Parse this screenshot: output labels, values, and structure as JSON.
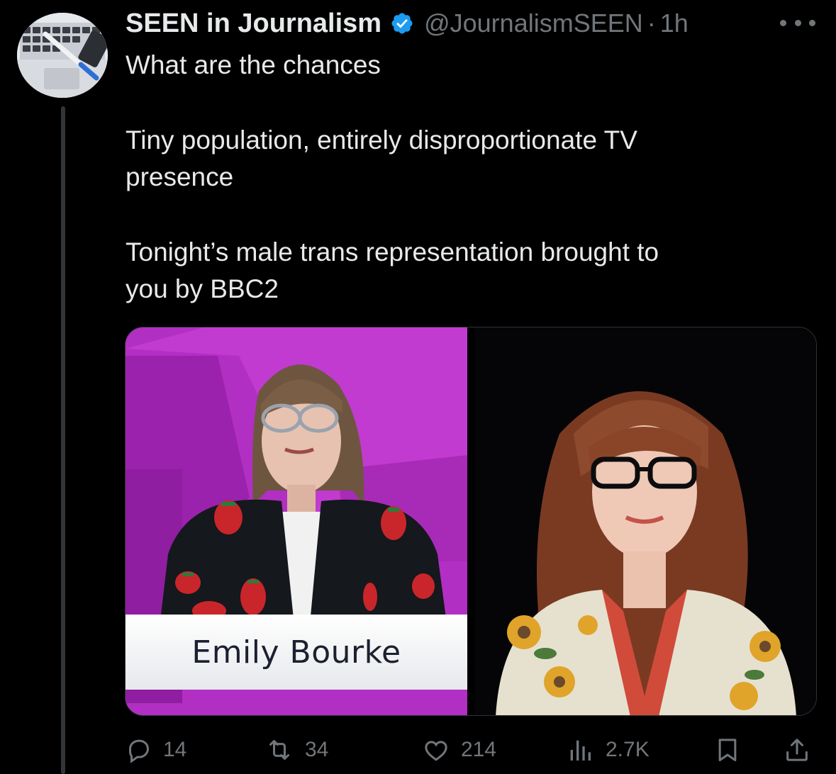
{
  "tweet": {
    "author": {
      "display_name": "SEEN in Journalism",
      "handle": "@JournalismSEEN",
      "verified": true,
      "avatar_icon": "laptop-keyboard-pen-avatar"
    },
    "separator": "·",
    "time": "1h",
    "text_lines": [
      "What are the chances",
      "Tiny population, entirely disproportionate TV",
      "presence",
      "Tonight’s male trans representation brought to",
      "you by BBC2"
    ],
    "media": {
      "left_caption": "Emily Bourke"
    },
    "actions": {
      "replies": "14",
      "reposts": "34",
      "likes": "214",
      "views": "2.7K"
    }
  },
  "colors": {
    "background": "#000000",
    "text": "#e7e9ea",
    "muted": "#71767b",
    "verified": "#1d9bf0",
    "studio_magenta": "#b02fc0"
  },
  "icons": {
    "verified": "verified-badge-icon",
    "more": "more-dots-icon",
    "reply": "reply-bubble-icon",
    "repost": "repost-arrows-icon",
    "like": "heart-icon",
    "views": "views-bar-chart-icon",
    "bookmark": "bookmark-icon",
    "share": "share-upload-icon"
  }
}
